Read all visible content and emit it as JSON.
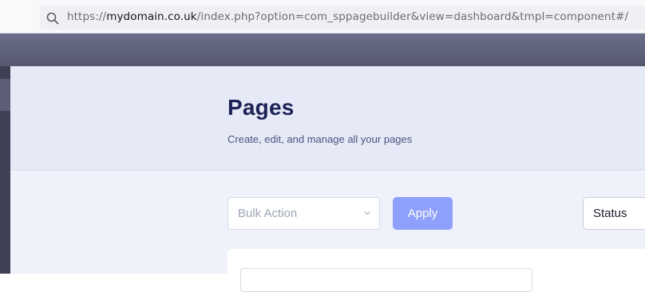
{
  "browser": {
    "url_prefix": "https://",
    "url_host": "mydomain.co.uk",
    "url_path": "/index.php?option=com_sppagebuilder&view=dashboard&tmpl=component#/",
    "search_icon": "search-icon"
  },
  "page": {
    "title": "Pages",
    "subtitle": "Create, edit, and manage all your pages"
  },
  "toolbar": {
    "bulk_action_placeholder": "Bulk Action",
    "apply_label": "Apply",
    "status_label": "Status"
  },
  "colors": {
    "accent": "#8ea0fb",
    "title": "#1c2356",
    "header_band": "#e6e9f6"
  }
}
